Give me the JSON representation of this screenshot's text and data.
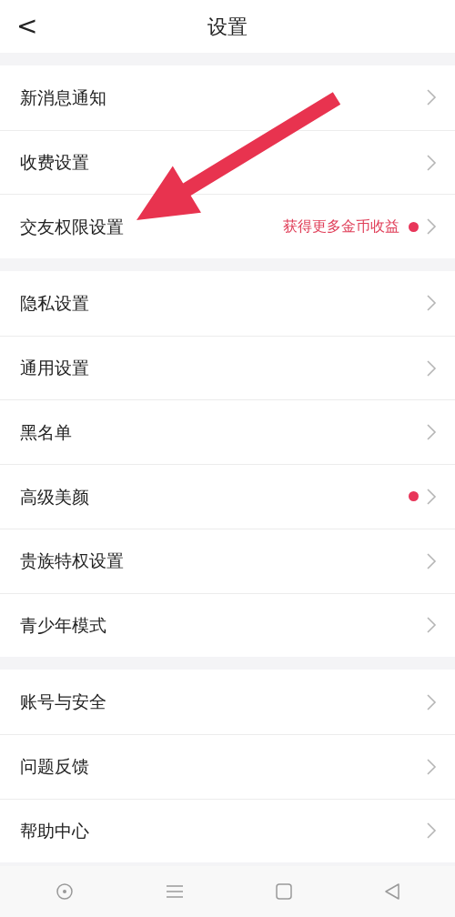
{
  "header": {
    "back": "<",
    "title": "设置"
  },
  "groups": [
    {
      "items": [
        {
          "label": "新消息通知",
          "dot": false
        },
        {
          "label": "收费设置",
          "dot": false
        },
        {
          "label": "交友权限设置",
          "note": "获得更多金币收益",
          "dot": true
        }
      ]
    },
    {
      "items": [
        {
          "label": "隐私设置",
          "dot": false
        },
        {
          "label": "通用设置",
          "dot": false
        },
        {
          "label": "黑名单",
          "dot": false
        },
        {
          "label": "高级美颜",
          "dot": true
        },
        {
          "label": "贵族特权设置",
          "dot": false
        },
        {
          "label": "青少年模式",
          "dot": false
        }
      ]
    },
    {
      "items": [
        {
          "label": "账号与安全",
          "dot": false
        },
        {
          "label": "问题反馈",
          "dot": false
        },
        {
          "label": "帮助中心",
          "dot": false
        }
      ]
    }
  ]
}
